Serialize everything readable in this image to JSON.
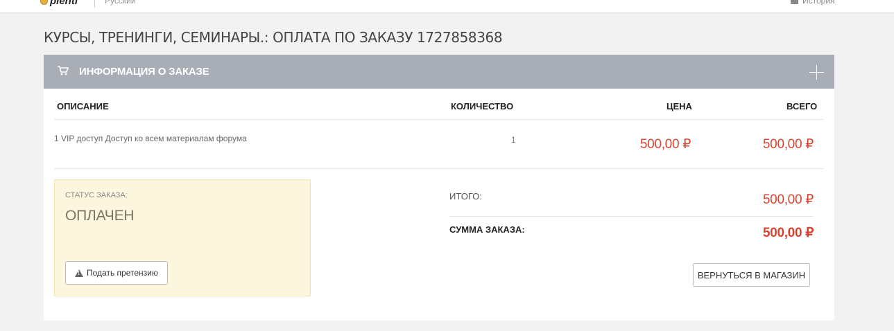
{
  "topbar": {
    "logo_text": "plenti",
    "language": "Русский",
    "history_label": "История"
  },
  "page_title": "КУРСЫ, ТРЕНИНГИ, СЕМИНАРЫ.: ОПЛАТА ПО ЗАКАЗУ 1727858368",
  "order_panel": {
    "title": "ИНФОРМАЦИЯ О ЗАКАЗЕ",
    "columns": [
      "ОПИСАНИЕ",
      "КОЛИЧЕСТВО",
      "ЦЕНА",
      "ВСЕГО"
    ],
    "rows": [
      {
        "description": "1 VIP доступ Доступ ко всем материалам форума",
        "quantity": "1",
        "price": "500,00 ₽",
        "total": "500,00 ₽"
      }
    ],
    "status": {
      "label": "СТАТУС ЗАКАЗА:",
      "value": "ОПЛАЧЕН",
      "claim_button": "Подать претензию"
    },
    "summary": {
      "subtotal_label": "ИТОГО:",
      "subtotal_value": "500,00 ₽",
      "total_label": "СУММА ЗАКАЗА:",
      "total_value": "500,00 ₽"
    },
    "back_button": "ВЕРНУТЬСЯ В МАГАЗИН"
  },
  "colors": {
    "header_bg": "#a9aeb6",
    "price_red": "#d64430",
    "status_bg": "#fdf6df"
  },
  "icons": [
    "logo-coin-icon",
    "history-icon",
    "cart-icon",
    "plus-icon",
    "warning-icon"
  ]
}
